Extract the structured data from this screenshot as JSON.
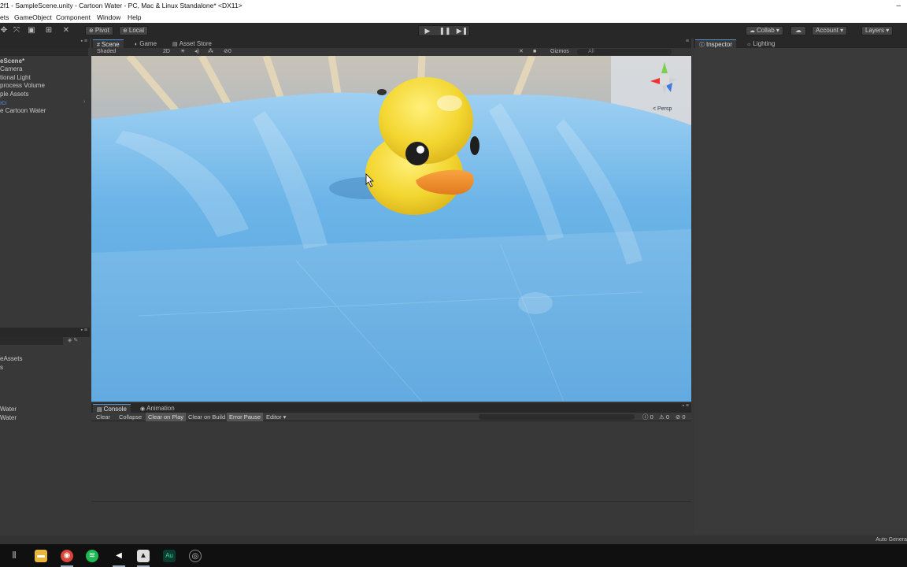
{
  "window": {
    "title": "2f1 - SampleScene.unity - Cartoon Water - PC, Mac & Linux Standalone* <DX11>",
    "minimize": "–"
  },
  "menu": {
    "assets": "ets",
    "gameobject": "GameObject",
    "component": "Component",
    "window": "Window",
    "help": "Help"
  },
  "toolbar": {
    "pivot": "Pivot",
    "local": "Local",
    "collab": "Collab",
    "account": "Account",
    "layers": "Layers"
  },
  "hierarchy": {
    "scene_name": "eScene*",
    "items": [
      "Camera",
      "tional Light",
      "process Volume",
      "ple Assets",
      "ıcı",
      "e Cartoon Water"
    ]
  },
  "project": {
    "items": [
      "eAssets",
      "s",
      "Water",
      "Water"
    ]
  },
  "scene": {
    "tabs": {
      "scene": "Scene",
      "game": "Game",
      "asset_store": "Asset Store"
    },
    "shading": "Shaded",
    "mode_2d": "2D",
    "gizmos": "Gizmos",
    "search_all": "All",
    "persp": "Persp"
  },
  "console": {
    "tabs": {
      "console": "Console",
      "animation": "Animation"
    },
    "buttons": {
      "clear": "Clear",
      "collapse": "Collapse",
      "clear_on_play": "Clear on Play",
      "clear_on_build": "Clear on Build",
      "error_pause": "Error Pause",
      "editor": "Editor"
    },
    "counts": {
      "info": "0",
      "warn": "0",
      "error": "0"
    }
  },
  "inspector": {
    "tabs": {
      "inspector": "Inspector",
      "lighting": "Lighting"
    }
  },
  "status": {
    "right_text": "Auto Genera"
  },
  "colors": {
    "accent": "#4e8fd8",
    "water": "#5aa9de",
    "duck": "#f2d531",
    "beak": "#f08a2a"
  }
}
